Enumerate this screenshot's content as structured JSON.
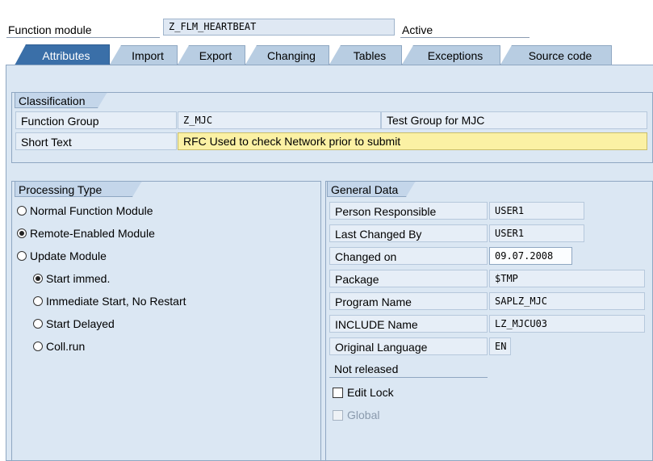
{
  "header": {
    "label": "Function module",
    "value": "Z_FLM_HEARTBEAT",
    "status": "Active"
  },
  "tabs": [
    {
      "label": "Attributes",
      "active": true
    },
    {
      "label": "Import"
    },
    {
      "label": "Export"
    },
    {
      "label": "Changing"
    },
    {
      "label": "Tables"
    },
    {
      "label": "Exceptions"
    },
    {
      "label": "Source code"
    }
  ],
  "classification": {
    "title": "Classification",
    "function_group_label": "Function Group",
    "function_group_value": "Z_MJC",
    "function_group_text": "Test Group for MJC",
    "short_text_label": "Short Text",
    "short_text_value": "RFC Used to check Network prior to submit"
  },
  "processing": {
    "title": "Processing Type",
    "options": [
      {
        "label": "Normal Function Module",
        "selected": false
      },
      {
        "label": "Remote-Enabled Module",
        "selected": true
      },
      {
        "label": "Update Module",
        "selected": false
      }
    ],
    "sub_options": [
      {
        "label": "Start immed.",
        "selected": true
      },
      {
        "label": "Immediate Start, No Restart",
        "selected": false
      },
      {
        "label": "Start Delayed",
        "selected": false
      },
      {
        "label": "Coll.run",
        "selected": false
      }
    ]
  },
  "general": {
    "title": "General Data",
    "rows": [
      {
        "label": "Person Responsible",
        "value": "USER1"
      },
      {
        "label": "Last Changed By",
        "value": "USER1"
      },
      {
        "label": "Changed on",
        "value": "09.07.2008"
      },
      {
        "label": "Package",
        "value": "$TMP"
      },
      {
        "label": "Program Name",
        "value": "SAPLZ_MJC"
      },
      {
        "label": "INCLUDE Name",
        "value": "LZ_MJCU03"
      },
      {
        "label": "Original Language",
        "value": "EN"
      }
    ],
    "release_status": "Not released",
    "edit_lock_label": "Edit Lock",
    "global_label": "Global"
  }
}
